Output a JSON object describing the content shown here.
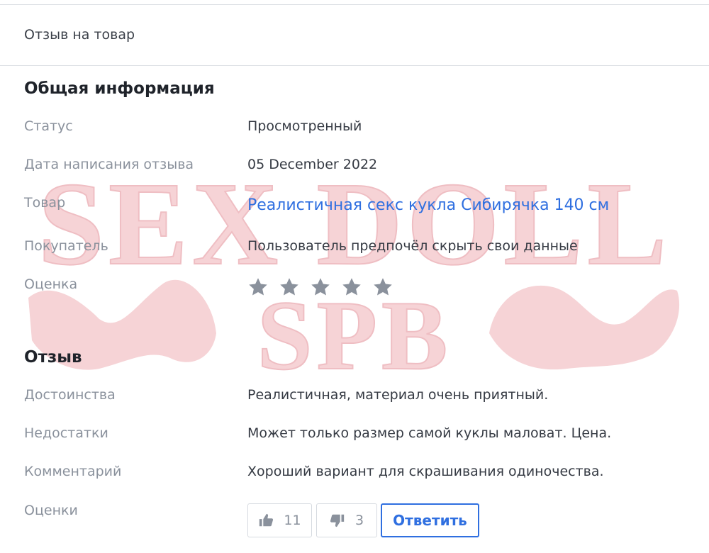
{
  "header": {
    "title": "Отзыв на товар"
  },
  "general": {
    "title": "Общая информация",
    "status_label": "Статус",
    "status_value": "Просмотренный",
    "date_label": "Дата написания отзыва",
    "date_value": "05 December 2022",
    "product_label": "Товар",
    "product_value": "Реалистичная секс кукла Сибирячка 140 см",
    "buyer_label": "Покупатель",
    "buyer_value": "Пользователь предпочёл скрыть свои данные",
    "rating_label": "Оценка",
    "rating_stars_total": 5
  },
  "review": {
    "title": "Отзыв",
    "pros_label": "Достоинства",
    "pros_value": "Реалистичная, материал очень приятный.",
    "cons_label": "Недостатки",
    "cons_value": "Может только размер самой куклы маловат. Цена.",
    "comment_label": "Комментарий",
    "comment_value": "Хороший вариант для скрашивания одиночества.",
    "votes_label": "Оценки",
    "likes": "11",
    "dislikes": "3",
    "reply_label": "Ответить"
  },
  "watermark": {
    "line1": "SEX DOLL",
    "line2": "SPB",
    "color": "#f3c9cd"
  },
  "colors": {
    "link": "#2f6fe0",
    "star": "#8a919c"
  }
}
